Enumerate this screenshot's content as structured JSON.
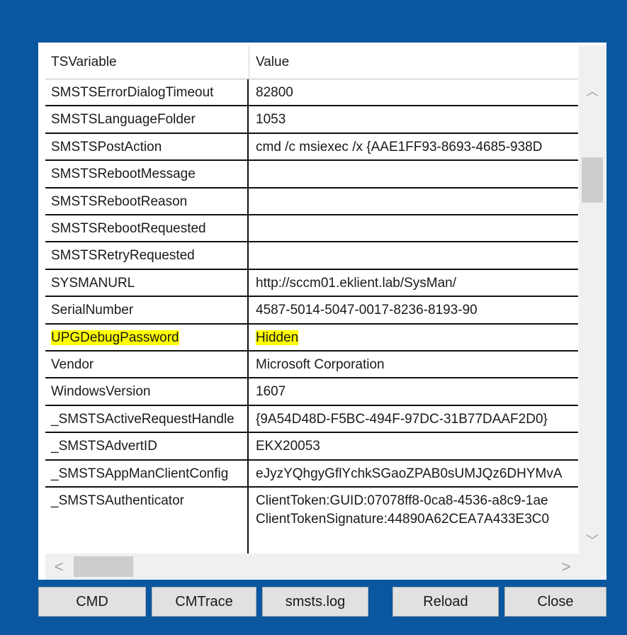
{
  "grid": {
    "columns": [
      "TSVariable",
      "Value"
    ],
    "rows": [
      {
        "name": "SMSTSErrorDialogTimeout",
        "value": "82800"
      },
      {
        "name": "SMSTSLanguageFolder",
        "value": "1053"
      },
      {
        "name": "SMSTSPostAction",
        "value": "cmd /c msiexec /x {AAE1FF93-8693-4685-938D"
      },
      {
        "name": "SMSTSRebootMessage",
        "value": ""
      },
      {
        "name": "SMSTSRebootReason",
        "value": ""
      },
      {
        "name": "SMSTSRebootRequested",
        "value": ""
      },
      {
        "name": "SMSTSRetryRequested",
        "value": ""
      },
      {
        "name": "SYSMANURL",
        "value": "http://sccm01.eklient.lab/SysMan/"
      },
      {
        "name": "SerialNumber",
        "value": "4587-5014-5047-0017-8236-8193-90"
      },
      {
        "name": "UPGDebugPassword",
        "value": "Hidden",
        "highlighted": true
      },
      {
        "name": "Vendor",
        "value": "Microsoft Corporation"
      },
      {
        "name": "WindowsVersion",
        "value": "1607"
      },
      {
        "name": "_SMSTSActiveRequestHandle",
        "value": "{9A54D48D-F5BC-494F-97DC-31B77DAAF2D0}"
      },
      {
        "name": "_SMSTSAdvertID",
        "value": "EKX20053"
      },
      {
        "name": "_SMSTSAppManClientConfig",
        "value": "eJyzYQhgyGflYchkSGaoZPAB0sUMJQz6DHYMvA"
      },
      {
        "name": "_SMSTSAuthenticator",
        "value": "ClientToken:GUID:07078ff8-0ca8-4536-a8c9-1ae",
        "value2": "ClientTokenSignature:44890A62CEA7A433E3C0"
      }
    ]
  },
  "scrollbar": {
    "up_glyph": "︿",
    "down_glyph": "﹀",
    "left_glyph": "<",
    "right_glyph": ">"
  },
  "buttons": {
    "cmd": "CMD",
    "cmtrace": "CMTrace",
    "smstslog": "smsts.log",
    "reload": "Reload",
    "close": "Close"
  },
  "colors": {
    "background": "#0a57a0",
    "highlight": "#ffff00"
  }
}
